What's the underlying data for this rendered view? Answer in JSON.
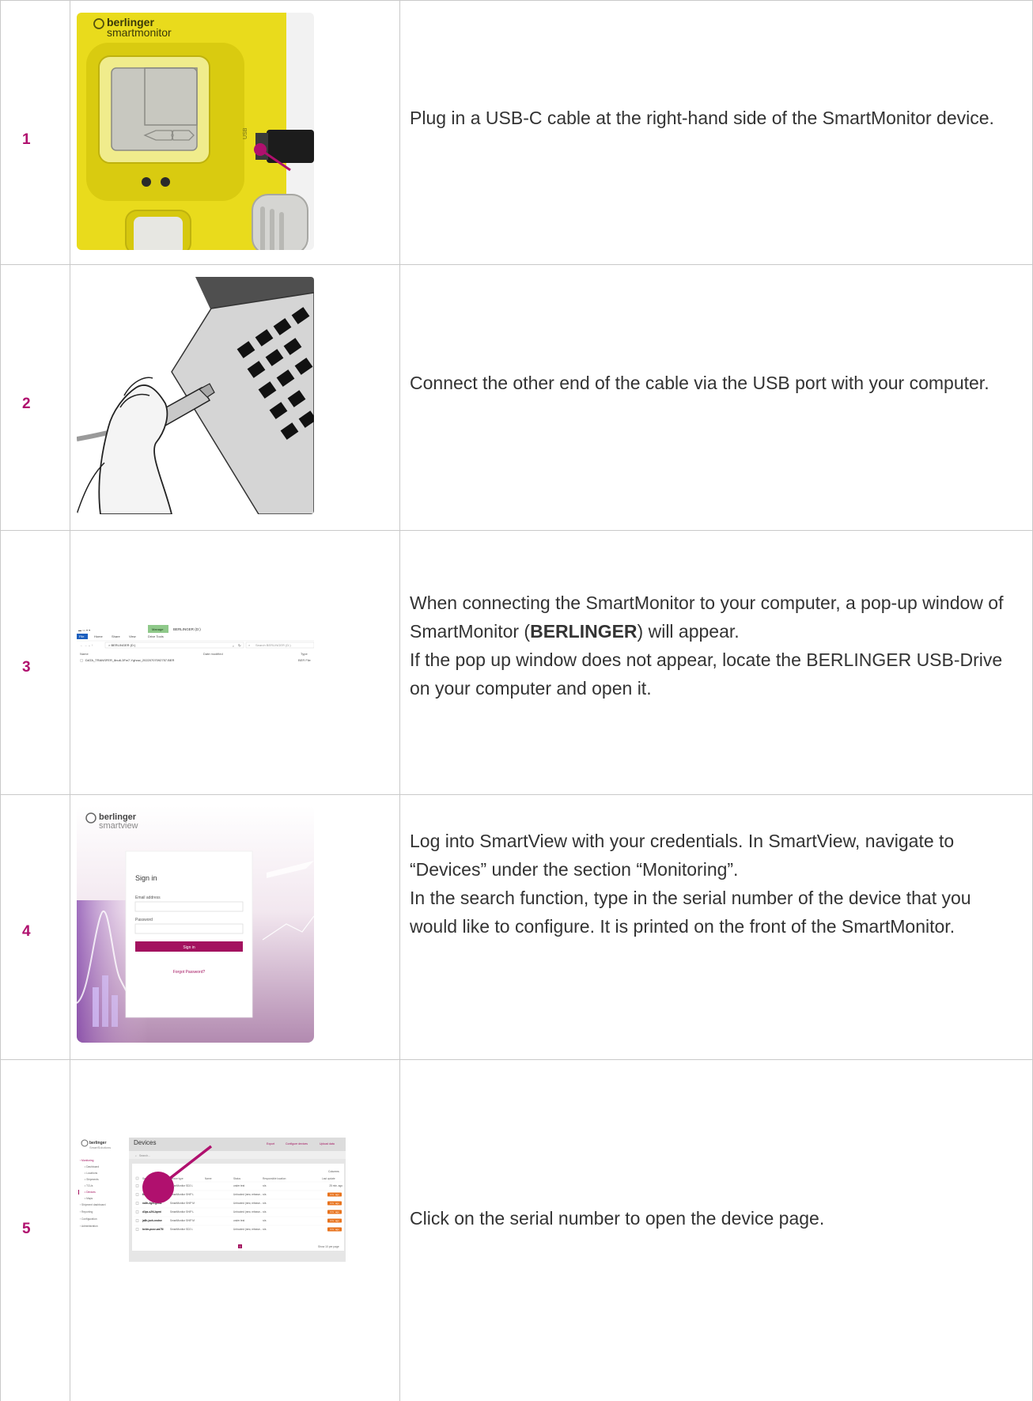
{
  "steps": [
    {
      "number": "1",
      "text": "Plug in a USB-C cable at the right-hand side of the SmartMonitor device.",
      "image": {
        "logo_line1": "berlinger",
        "logo_line2": "smartmonitor",
        "port_label": "USB"
      }
    },
    {
      "number": "2",
      "text": "Connect the other end of the cable via the USB port with your computer."
    },
    {
      "number": "3",
      "text_line1_a": "When connecting the SmartMonitor to your computer, a pop-up window of SmartMonitor (",
      "text_line1_bold": "BERLINGER",
      "text_line1_b": ") will appear.",
      "text_line2": "If the pop up window does not appear, locate the BERLINGER USB-Drive on your computer and open it.",
      "image": {
        "ribbon_manage": "Manage",
        "window_title": "BERLINGER (D:)",
        "tab_file": "File",
        "tab_home": "Home",
        "tab_share": "Share",
        "tab_view": "View",
        "tab_drive_tools": "Drive Tools",
        "path": "> BERLINGER (D:)",
        "search_placeholder": "Search BERLINGER (D:)",
        "col_name": "Name",
        "col_date": "Date modified",
        "col_type": "Type",
        "file_name": "DATA_TRANSFER_8nu6-3Fw7-Yghow_20220707092757.BER",
        "file_type": "BER File"
      }
    },
    {
      "number": "4",
      "text_line1": "Log into SmartView with your credentials. In SmartView, navigate to “Devices” under the section “Monitoring”.",
      "text_line2": "In the search function, type in the serial number of the device that you would like to configure. It is printed on the front of the SmartMonitor.",
      "image": {
        "logo_line1": "berlinger",
        "logo_line2": "smartview",
        "sign_in_title": "Sign in",
        "email_label": "Email address",
        "password_label": "Password",
        "sign_in_button": "Sign in",
        "forgot_link": "Forgot Password?"
      }
    },
    {
      "number": "5",
      "text": "Click on the serial number to open the device page.",
      "image": {
        "logo_line1": "berlinger",
        "logo_line2": "SmartSolutions",
        "page_title": "Devices",
        "search_placeholder": "Search...",
        "action_export": "Export",
        "action_configure": "Configure devices",
        "action_upload": "Upload data",
        "columns_button": "Columns",
        "nav": [
          {
            "label": "Monitoring",
            "type": "section"
          },
          {
            "label": "Dashboard",
            "type": "item"
          },
          {
            "label": "Locations",
            "type": "item"
          },
          {
            "label": "Shipments",
            "type": "item"
          },
          {
            "label": "TCUs",
            "type": "item"
          },
          {
            "label": "Devices",
            "type": "active"
          },
          {
            "label": "Maps",
            "type": "item"
          },
          {
            "label": "Shipment dashboard",
            "type": "section"
          },
          {
            "label": "Reporting",
            "type": "section"
          },
          {
            "label": "Configuration",
            "type": "section"
          },
          {
            "label": "Administration",
            "type": "section"
          }
        ],
        "headers": [
          "Serial No.",
          "Device type",
          "Name",
          "Status",
          "Responsible location",
          "Last update"
        ],
        "rows": [
          {
            "serial": "48vm-y3wt-ny92",
            "type": "SmartMonitor SD2 L",
            "status": "under test",
            "location": "n/a",
            "update": "25 min. ago",
            "badge": false
          },
          {
            "serial": "63vj-ohr-nh8qs",
            "type": "SmartMonitor SHIP L",
            "status": "Unbooted (new, release...",
            "location": "n/a",
            "update": "3 hr. ago",
            "badge": true
          },
          {
            "serial": "na9n-3gin-gxm4",
            "type": "SmartMonitor SHIP M",
            "status": "Unbooted (new, release...",
            "location": "n/a",
            "update": "3 hr. ago",
            "badge": true
          },
          {
            "serial": "d3ps-s2f4-bpmt",
            "type": "SmartMonitor SHIP L",
            "status": "Unbooted (new, release...",
            "location": "n/a",
            "update": "3 hr. ago",
            "badge": true
          },
          {
            "serial": "ja8h-jsnh-nndrw",
            "type": "SmartMonitor SHIP M",
            "status": "under test",
            "location": "n/a",
            "update": "3 hr. ago",
            "badge": true
          },
          {
            "serial": "be4m-pusv-wa75l",
            "type": "SmartMonitor SD2 L",
            "status": "Unbooted (new, release...",
            "location": "n/a",
            "update": "3 hr. ago",
            "badge": true
          }
        ],
        "page_current": "1",
        "per_page_label": "Show 10 per page"
      }
    }
  ]
}
